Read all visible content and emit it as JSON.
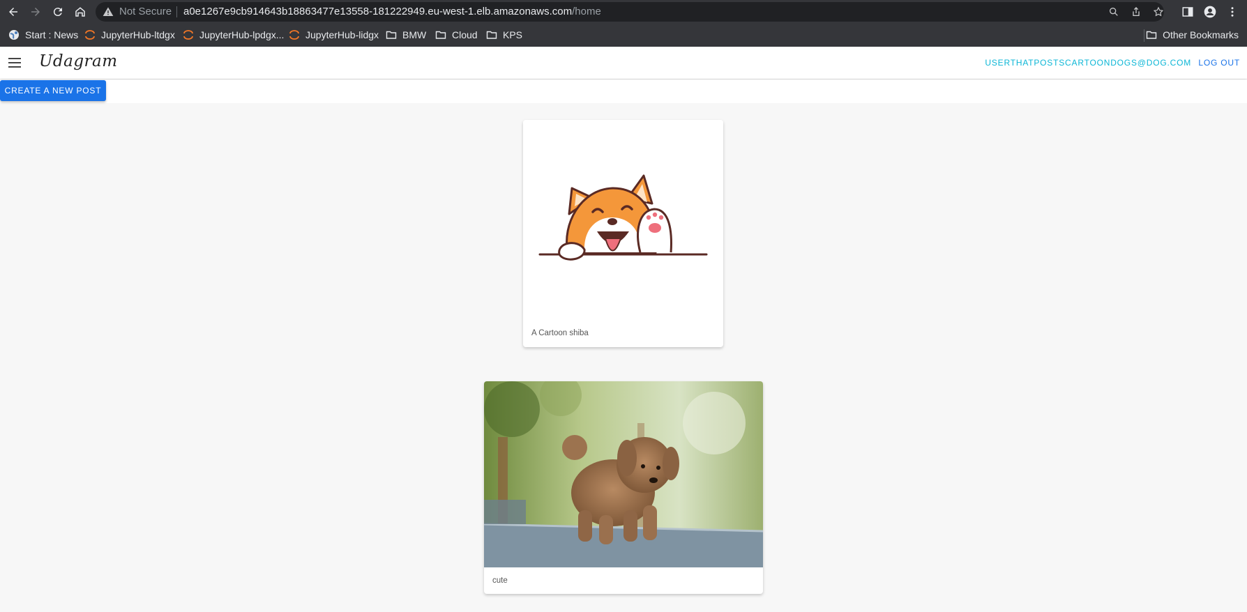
{
  "browser": {
    "url_host": "a0e1267e9cb914643b18863477e13558-181222949.eu-west-1.elb.amazonaws.com",
    "url_path": "/home",
    "security_label": "Not Secure"
  },
  "bookmarks": {
    "items": [
      {
        "label": "Start : News",
        "icon": "globe-icon"
      },
      {
        "label": "JupyterHub-ltdgx",
        "icon": "jupyter-icon"
      },
      {
        "label": "JupyterHub-lpdgx...",
        "icon": "jupyter-icon"
      },
      {
        "label": "JupyterHub-lidgx",
        "icon": "jupyter-icon"
      },
      {
        "label": "BMW",
        "icon": "folder-icon"
      },
      {
        "label": "Cloud",
        "icon": "folder-icon"
      },
      {
        "label": "KPS",
        "icon": "folder-icon"
      }
    ],
    "other": "Other Bookmarks"
  },
  "app": {
    "brand": "Udagram",
    "user_email": "USERTHATPOSTSCARTOONDOGS@DOG.COM",
    "logout_label": "LOG OUT",
    "create_label": "CREATE A NEW POST"
  },
  "feed": [
    {
      "caption": "A Cartoon shiba",
      "image": "cartoon-shiba-image"
    },
    {
      "caption": "cute",
      "image": "poodle-puppy-photo"
    }
  ],
  "colors": {
    "accent": "#1a73e8",
    "email": "#0bb6d6",
    "chrome": "#35363a"
  }
}
